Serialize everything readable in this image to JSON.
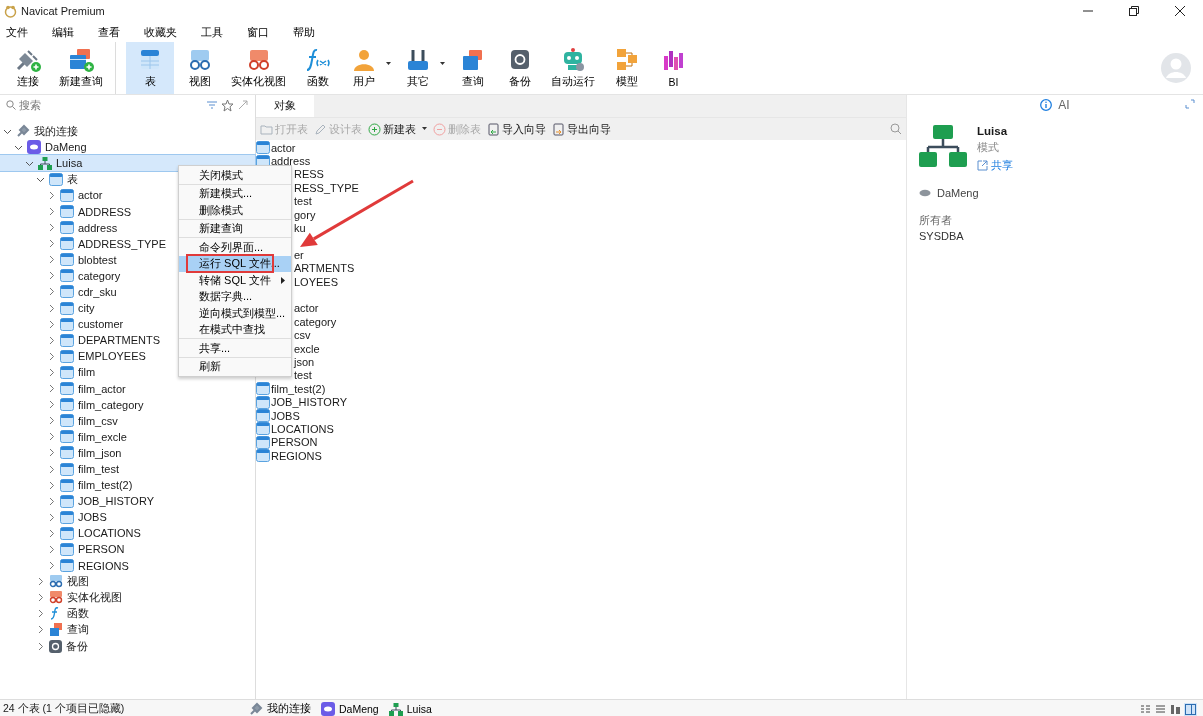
{
  "window": {
    "title": "Navicat Premium"
  },
  "menu_bar": [
    "文件",
    "编辑",
    "查看",
    "收藏夹",
    "工具",
    "窗口",
    "帮助"
  ],
  "toolbar": [
    {
      "label": "连接",
      "kind": "connect",
      "selected": false,
      "dropdown": false,
      "group_end": false
    },
    {
      "label": "新建查询",
      "kind": "newquery",
      "selected": false,
      "dropdown": false,
      "group_end": true
    },
    {
      "label": "表",
      "kind": "table",
      "selected": true,
      "dropdown": false,
      "group_end": false
    },
    {
      "label": "视图",
      "kind": "view",
      "selected": false,
      "dropdown": false,
      "group_end": false
    },
    {
      "label": "实体化视图",
      "kind": "matview",
      "selected": false,
      "dropdown": false,
      "group_end": false
    },
    {
      "label": "函数",
      "kind": "function",
      "selected": false,
      "dropdown": false,
      "group_end": false
    },
    {
      "label": "用户",
      "kind": "user",
      "selected": false,
      "dropdown": true,
      "group_end": false
    },
    {
      "label": "其它",
      "kind": "other",
      "selected": false,
      "dropdown": true,
      "group_end": false
    },
    {
      "label": "查询",
      "kind": "query",
      "selected": false,
      "dropdown": false,
      "group_end": false
    },
    {
      "label": "备份",
      "kind": "backup",
      "selected": false,
      "dropdown": false,
      "group_end": false
    },
    {
      "label": "自动运行",
      "kind": "robot",
      "selected": false,
      "dropdown": false,
      "group_end": false
    },
    {
      "label": "模型",
      "kind": "model",
      "selected": false,
      "dropdown": false,
      "group_end": false
    },
    {
      "label": "BI",
      "kind": "bi",
      "selected": false,
      "dropdown": false,
      "group_end": false
    }
  ],
  "sidebar": {
    "search": {
      "placeholder": "搜索"
    },
    "tree": [
      {
        "label": "我的连接",
        "kind": "group",
        "expanded": true,
        "selected": false,
        "children": [
          {
            "label": "DaMeng",
            "kind": "connection",
            "expanded": true,
            "selected": false,
            "children": [
              {
                "label": "Luisa",
                "kind": "schema",
                "expanded": true,
                "selected": true,
                "children": [
                  {
                    "label": "表",
                    "kind": "tables",
                    "expanded": true,
                    "selected": false,
                    "children": [
                      {
                        "label": "actor",
                        "kind": "table",
                        "expanded": false,
                        "selected": false
                      },
                      {
                        "label": "ADDRESS",
                        "kind": "table",
                        "expanded": false,
                        "selected": false
                      },
                      {
                        "label": "address",
                        "kind": "table",
                        "expanded": false,
                        "selected": false
                      },
                      {
                        "label": "ADDRESS_TYPE",
                        "kind": "table",
                        "expanded": false,
                        "selected": false
                      },
                      {
                        "label": "blobtest",
                        "kind": "table",
                        "expanded": false,
                        "selected": false
                      },
                      {
                        "label": "category",
                        "kind": "table",
                        "expanded": false,
                        "selected": false
                      },
                      {
                        "label": "cdr_sku",
                        "kind": "table",
                        "expanded": false,
                        "selected": false
                      },
                      {
                        "label": "city",
                        "kind": "table",
                        "expanded": false,
                        "selected": false
                      },
                      {
                        "label": "customer",
                        "kind": "table",
                        "expanded": false,
                        "selected": false
                      },
                      {
                        "label": "DEPARTMENTS",
                        "kind": "table",
                        "expanded": false,
                        "selected": false
                      },
                      {
                        "label": "EMPLOYEES",
                        "kind": "table",
                        "expanded": false,
                        "selected": false
                      },
                      {
                        "label": "film",
                        "kind": "table",
                        "expanded": false,
                        "selected": false
                      },
                      {
                        "label": "film_actor",
                        "kind": "table",
                        "expanded": false,
                        "selected": false
                      },
                      {
                        "label": "film_category",
                        "kind": "table",
                        "expanded": false,
                        "selected": false
                      },
                      {
                        "label": "film_csv",
                        "kind": "table",
                        "expanded": false,
                        "selected": false
                      },
                      {
                        "label": "film_excle",
                        "kind": "table",
                        "expanded": false,
                        "selected": false
                      },
                      {
                        "label": "film_json",
                        "kind": "table",
                        "expanded": false,
                        "selected": false
                      },
                      {
                        "label": "film_test",
                        "kind": "table",
                        "expanded": false,
                        "selected": false
                      },
                      {
                        "label": "film_test(2)",
                        "kind": "table",
                        "expanded": false,
                        "selected": false
                      },
                      {
                        "label": "JOB_HISTORY",
                        "kind": "table",
                        "expanded": false,
                        "selected": false
                      },
                      {
                        "label": "JOBS",
                        "kind": "table",
                        "expanded": false,
                        "selected": false
                      },
                      {
                        "label": "LOCATIONS",
                        "kind": "table",
                        "expanded": false,
                        "selected": false
                      },
                      {
                        "label": "PERSON",
                        "kind": "table",
                        "expanded": false,
                        "selected": false
                      },
                      {
                        "label": "REGIONS",
                        "kind": "table",
                        "expanded": false,
                        "selected": false
                      }
                    ]
                  },
                  {
                    "label": "视图",
                    "kind": "views",
                    "expanded": false,
                    "selected": false
                  },
                  {
                    "label": "实体化视图",
                    "kind": "matviews",
                    "expanded": false,
                    "selected": false
                  },
                  {
                    "label": "函数",
                    "kind": "functions",
                    "expanded": false,
                    "selected": false
                  },
                  {
                    "label": "查询",
                    "kind": "queries",
                    "expanded": false,
                    "selected": false
                  },
                  {
                    "label": "备份",
                    "kind": "backups",
                    "expanded": false,
                    "selected": false
                  }
                ]
              }
            ]
          }
        ]
      }
    ]
  },
  "objects": {
    "tabs": [
      {
        "label": "对象",
        "selected": true
      }
    ],
    "tools": [
      {
        "label": "打开表",
        "kind": "open",
        "disabled": true,
        "dropdown": false
      },
      {
        "label": "设计表",
        "kind": "design",
        "disabled": true,
        "dropdown": false
      },
      {
        "label": "新建表",
        "kind": "new",
        "disabled": false,
        "dropdown": true
      },
      {
        "label": "删除表",
        "kind": "delete",
        "disabled": true,
        "dropdown": false
      },
      {
        "label": "导入向导",
        "kind": "import",
        "disabled": false,
        "dropdown": false
      },
      {
        "label": "导出向导",
        "kind": "export",
        "disabled": false,
        "dropdown": false
      }
    ],
    "items": [
      {
        "text": "actor",
        "covered": false
      },
      {
        "text": "address",
        "covered": false
      },
      {
        "text": "RESS",
        "covered": true
      },
      {
        "text": "RESS_TYPE",
        "covered": true
      },
      {
        "text": "test",
        "covered": true
      },
      {
        "text": "gory",
        "covered": true
      },
      {
        "text": "ku",
        "covered": true
      },
      {
        "text": "er",
        "covered": true,
        "after_hidden_row": true
      },
      {
        "text": "ARTMENTS",
        "covered": true
      },
      {
        "text": "LOYEES",
        "covered": true
      },
      {
        "text": "actor",
        "covered": true,
        "after_hidden_row": true
      },
      {
        "text": "category",
        "covered": true
      },
      {
        "text": "csv",
        "covered": true
      },
      {
        "text": "excle",
        "covered": true
      },
      {
        "text": "json",
        "covered": true
      },
      {
        "text": "test",
        "covered": true
      },
      {
        "text": "film_test(2)",
        "covered": false
      },
      {
        "text": "JOB_HISTORY",
        "covered": false
      },
      {
        "text": "JOBS",
        "covered": false
      },
      {
        "text": "LOCATIONS",
        "covered": false
      },
      {
        "text": "PERSON",
        "covered": false
      },
      {
        "text": "REGIONS",
        "covered": false
      }
    ]
  },
  "context_menu": [
    {
      "label": "关闭模式",
      "selected": false,
      "separator_after": true,
      "submenu": false
    },
    {
      "label": "新建模式...",
      "selected": false,
      "separator_after": false,
      "submenu": false
    },
    {
      "label": "删除模式",
      "selected": false,
      "separator_after": true,
      "submenu": false
    },
    {
      "label": "新建查询",
      "selected": false,
      "separator_after": true,
      "submenu": false
    },
    {
      "label": "命令列界面...",
      "selected": false,
      "separator_after": false,
      "submenu": false
    },
    {
      "label": "运行 SQL 文件...",
      "selected": true,
      "separator_after": false,
      "submenu": false
    },
    {
      "label": "转储 SQL 文件",
      "selected": false,
      "separator_after": false,
      "submenu": true
    },
    {
      "label": "数据字典...",
      "selected": false,
      "separator_after": false,
      "submenu": false
    },
    {
      "label": "逆向模式到模型...",
      "selected": false,
      "separator_after": false,
      "submenu": false
    },
    {
      "label": "在模式中查找",
      "selected": false,
      "separator_after": true,
      "submenu": false
    },
    {
      "label": "共享...",
      "selected": false,
      "separator_after": true,
      "submenu": false
    },
    {
      "label": "刷新",
      "selected": false,
      "separator_after": false,
      "submenu": false
    }
  ],
  "info_panel": {
    "tab": "AI",
    "name": "Luisa",
    "type": "模式",
    "share": "共享",
    "connection": "DaMeng",
    "owner_label": "所有者",
    "owner": "SYSDBA"
  },
  "status_bar": {
    "summary": "24 个表 (1 个项目已隐藏)",
    "breadcrumbs": [
      {
        "label": "我的连接",
        "kind": "group"
      },
      {
        "label": "DaMeng",
        "kind": "connection"
      },
      {
        "label": "Luisa",
        "kind": "schema"
      }
    ],
    "views": [
      {
        "kind": "list",
        "selected": false
      },
      {
        "kind": "detail",
        "selected": false
      },
      {
        "kind": "er",
        "selected": false
      },
      {
        "kind": "panel",
        "selected": true
      }
    ]
  }
}
